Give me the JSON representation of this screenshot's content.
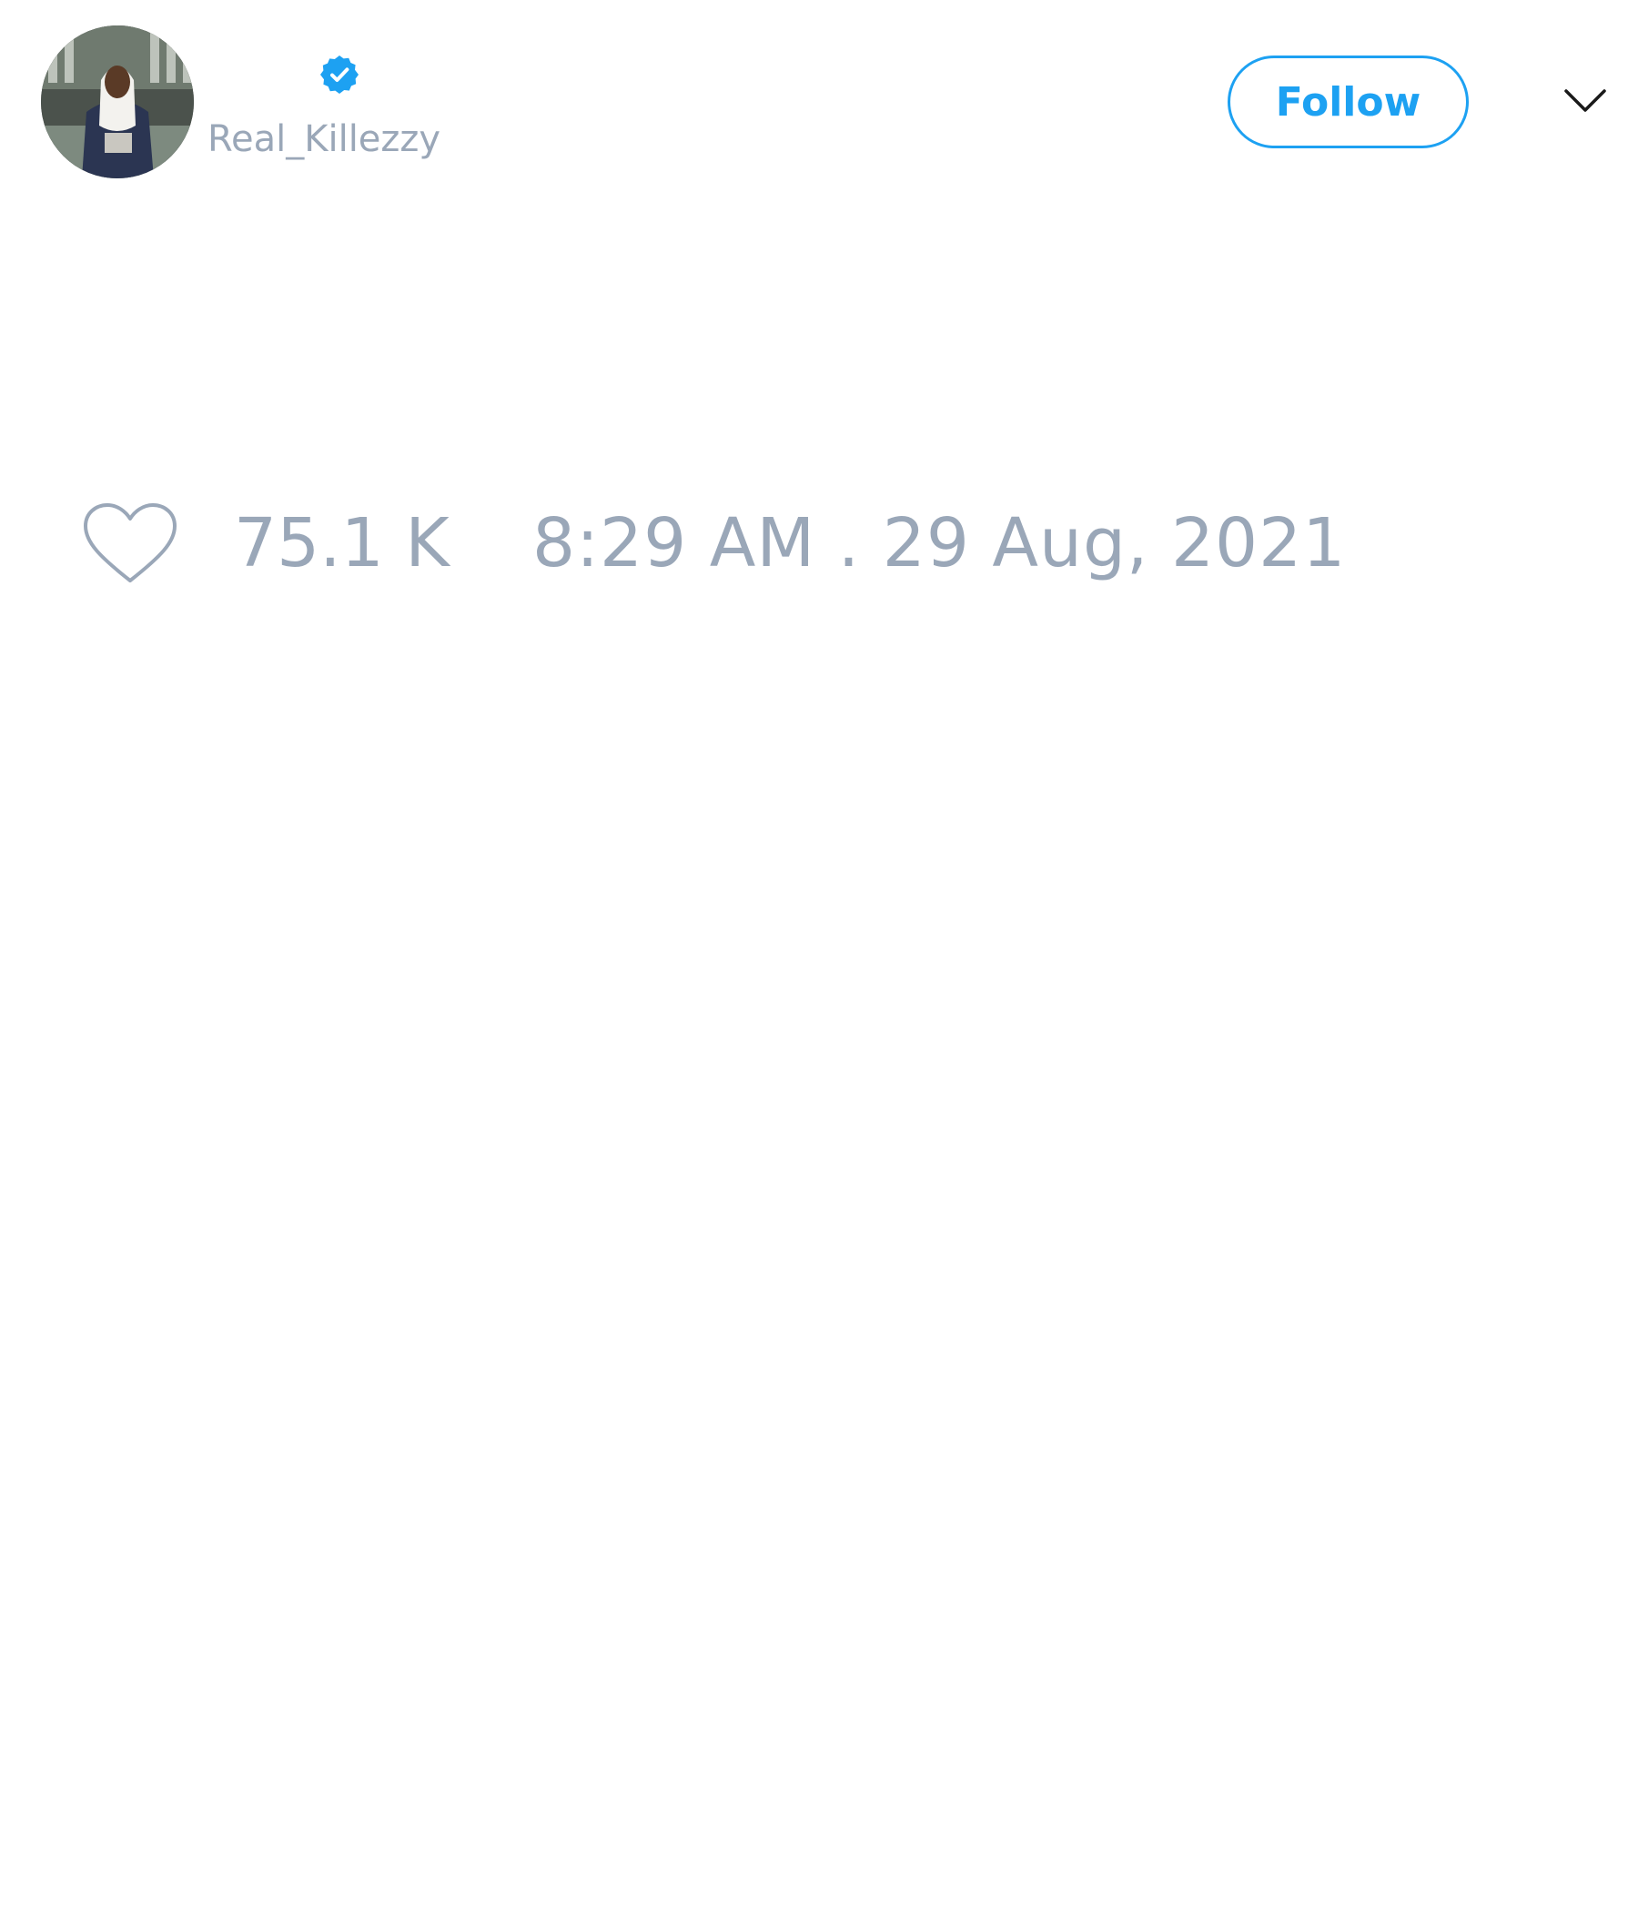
{
  "user": {
    "handle": "Real_Killezzy",
    "verified": true,
    "avatar_icon": "user-avatar-photo"
  },
  "header": {
    "follow_label": "Follow",
    "menu_icon": "chevron-down-icon"
  },
  "tweet": {
    "like_icon": "heart-outline-icon",
    "like_count": "75.1 K",
    "timestamp": "8:29 AM . 29 Aug, 2021"
  },
  "colors": {
    "accent": "#1da1f2",
    "muted_text": "#9aa7b8",
    "background": "#ffffff"
  }
}
